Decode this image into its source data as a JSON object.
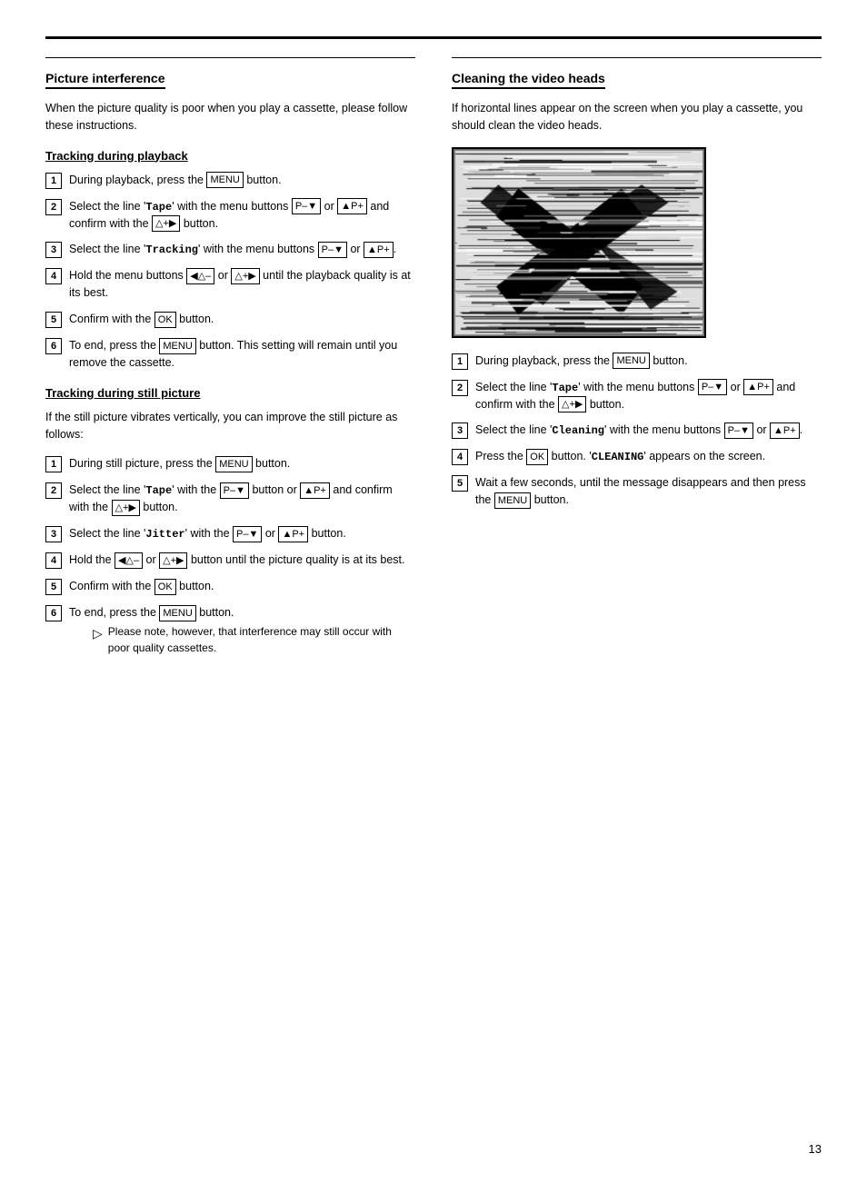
{
  "page": {
    "number": "13",
    "top_border": true
  },
  "left_column": {
    "section_title": "Picture interference",
    "intro_text": "When the picture quality is poor when you play a cassette, please follow these instructions.",
    "subsection1": {
      "title": "Tracking during playback",
      "steps": [
        {
          "num": "1",
          "text_before": "During playback, press the ",
          "button1": "MENU",
          "text_after": " button."
        },
        {
          "num": "2",
          "text_before": "Select the line '",
          "mono1": "Tape",
          "text_mid": "' with the menu buttons ",
          "button1": "P–▼",
          "text_mid2": " or ",
          "button2": "▲P+",
          "text_mid3": " and confirm with the ",
          "button3": "△+▶",
          "text_after": " button."
        },
        {
          "num": "3",
          "text_before": "Select the line '",
          "mono1": "Tracking",
          "text_mid": "' with the menu buttons ",
          "button1": "P–▼",
          "text_mid2": " or ",
          "button2": "▲P+",
          "text_after": "."
        },
        {
          "num": "4",
          "text_before": "Hold the menu buttons ",
          "button1": "◀△–",
          "text_mid": " or ",
          "button2": "△+▶",
          "text_after": " until the playback quality is at its best."
        },
        {
          "num": "5",
          "text_before": "Confirm with the ",
          "button1": "OK",
          "text_after": " button."
        },
        {
          "num": "6",
          "text_before": "To end, press the ",
          "button1": "MENU",
          "text_after": " button. This setting will remain until you remove the cassette."
        }
      ]
    },
    "subsection2": {
      "title": "Tracking during still picture",
      "intro": "If the still picture vibrates vertically, you can improve the still picture as follows:",
      "steps": [
        {
          "num": "1",
          "text_before": "During still picture, press the ",
          "button1": "MENU",
          "text_after": " button."
        },
        {
          "num": "2",
          "text_before": "Select the line '",
          "mono1": "Tape",
          "text_mid": "' with the ",
          "button1": "P–▼",
          "text_mid2": " button or ",
          "button2": "▲P+",
          "text_mid3": " and confirm with the ",
          "button3": "△+▶",
          "text_after": " button."
        },
        {
          "num": "3",
          "text_before": "Select the line '",
          "mono1": "Jitter",
          "text_mid": "' with the ",
          "button1": "P–▼",
          "text_mid2": " or ",
          "button2": "▲P+",
          "text_after": " button."
        },
        {
          "num": "4",
          "text_before": "Hold the ",
          "button1": "◀△–",
          "text_mid": " or ",
          "button2": "△+▶",
          "text_after": " button until the picture quality is at its best."
        },
        {
          "num": "5",
          "text_before": "Confirm with the ",
          "button1": "OK",
          "text_after": " button."
        },
        {
          "num": "6",
          "text_before": "To end, press the ",
          "button1": "MENU",
          "text_after": " button.",
          "note": "Please note, however, that interference may still occur with poor quality cassettes."
        }
      ]
    }
  },
  "right_column": {
    "section_title": "Cleaning the video heads",
    "intro_text": "If horizontal lines appear on the screen when you play a cassette, you should clean the video heads.",
    "steps": [
      {
        "num": "1",
        "text_before": "During playback, press the ",
        "button1": "MENU",
        "text_after": " button."
      },
      {
        "num": "2",
        "text_before": "Select the line '",
        "mono1": "Tape",
        "text_mid": "' with the menu buttons ",
        "button1": "P–▼",
        "text_mid2": " or ",
        "button2": "▲P+",
        "text_mid3": " and confirm with the ",
        "button3": "△+▶",
        "text_after": " button."
      },
      {
        "num": "3",
        "text_before": "Select the line '",
        "mono1": "Cleaning",
        "text_mid": "' with the menu buttons ",
        "button1": "P–▼",
        "text_mid2": " or ",
        "button2": "▲P+",
        "text_after": "."
      },
      {
        "num": "4",
        "text_before": "Press the ",
        "button1": "OK",
        "text_mid": " button. '",
        "mono1": "CLEANING",
        "text_after": "' appears on the screen."
      },
      {
        "num": "5",
        "text_before": "Wait a few seconds, until the message disappears and then press the ",
        "button1": "MENU",
        "text_after": " button."
      }
    ]
  }
}
